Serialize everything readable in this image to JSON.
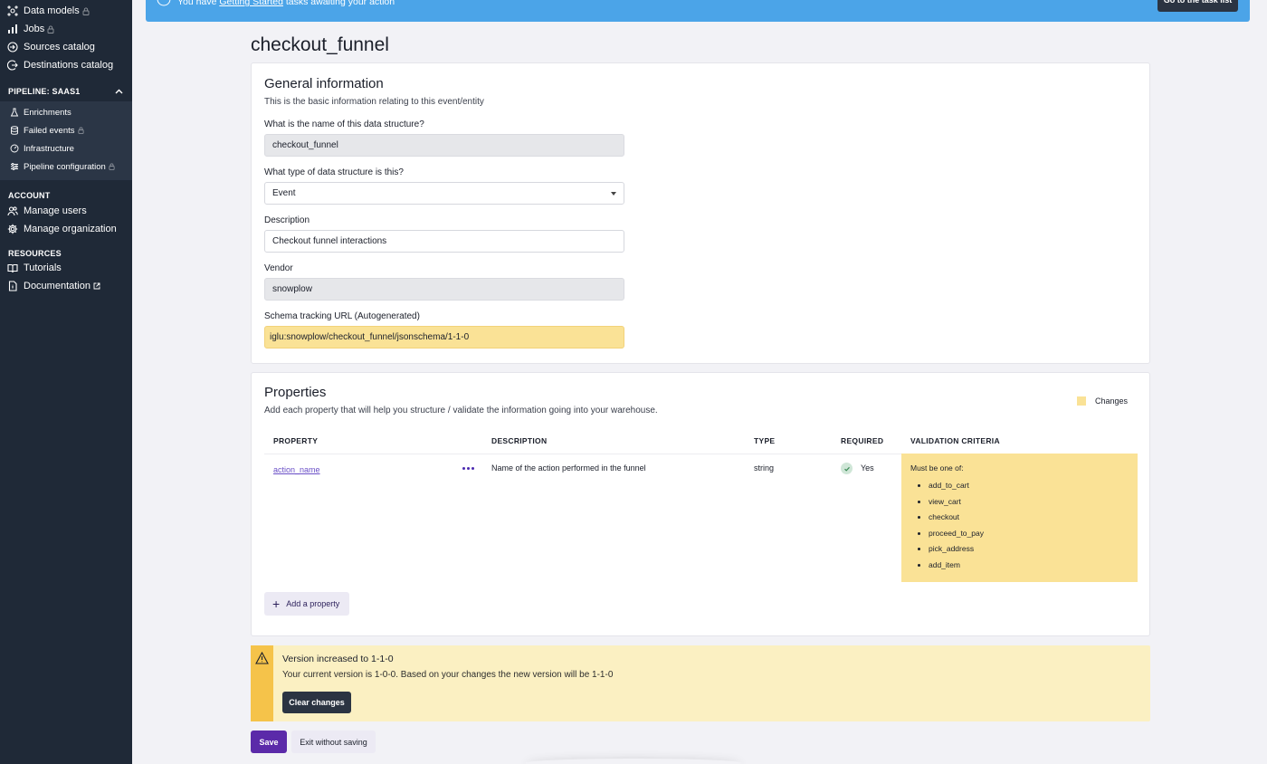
{
  "sidebar": {
    "top_items": [
      {
        "label": "Data models",
        "icon": "data-models-icon",
        "locked": true
      },
      {
        "label": "Jobs",
        "icon": "bar-chart-icon",
        "locked": true
      },
      {
        "label": "Sources catalog",
        "icon": "sources-icon",
        "locked": false
      },
      {
        "label": "Destinations catalog",
        "icon": "destinations-icon",
        "locked": false
      }
    ],
    "pipeline": {
      "header": "PIPELINE: SAAS1",
      "items": [
        {
          "label": "Enrichments",
          "icon": "flask-icon",
          "locked": false
        },
        {
          "label": "Failed events",
          "icon": "database-icon",
          "locked": true
        },
        {
          "label": "Infrastructure",
          "icon": "gauge-icon",
          "locked": false
        },
        {
          "label": "Pipeline configuration",
          "icon": "sliders-icon",
          "locked": true
        }
      ]
    },
    "account": {
      "label": "ACCOUNT",
      "items": [
        {
          "label": "Manage users",
          "icon": "users-icon"
        },
        {
          "label": "Manage organization",
          "icon": "gear-icon"
        }
      ]
    },
    "resources": {
      "label": "RESOURCES",
      "items": [
        {
          "label": "Tutorials",
          "icon": "book-icon"
        },
        {
          "label": "Documentation",
          "icon": "document-icon"
        }
      ]
    }
  },
  "banner": {
    "text_before": "You have ",
    "link": "Getting Started",
    "text_after": " tasks awaiting your action",
    "button": "Go to the task list"
  },
  "page_title": "checkout_funnel",
  "general": {
    "title": "General information",
    "subtitle": "This is the basic information relating to this event/entity",
    "name_label": "What is the name of this data structure?",
    "name_value": "checkout_funnel",
    "type_label": "What type of data structure is this?",
    "type_value": "Event",
    "description_label": "Description",
    "description_value": "Checkout funnel interactions",
    "vendor_label": "Vendor",
    "vendor_value": "snowplow",
    "url_label": "Schema tracking URL (Autogenerated)",
    "url_value": "iglu:snowplow/checkout_funnel/jsonschema/1-1-0"
  },
  "properties": {
    "title": "Properties",
    "subtitle": "Add each property that will help you structure / validate the information going into your warehouse.",
    "legend": "Changes",
    "legend_color": "#fae296",
    "columns": {
      "property": "PROPERTY",
      "description": "DESCRIPTION",
      "type": "TYPE",
      "required": "REQUIRED",
      "validation": "VALIDATION CRITERIA"
    },
    "row": {
      "name": "action_name",
      "description": "Name of the action performed in the funnel",
      "type": "string",
      "required": "Yes",
      "validation_intro": "Must be one of:",
      "validation_values": [
        "add_to_cart",
        "view_cart",
        "checkout",
        "proceed_to_pay",
        "pick_address",
        "add_item"
      ]
    },
    "add_button": "Add a property"
  },
  "warning": {
    "title": "Version increased to 1-1-0",
    "text": "Your current version is 1-0-0. Based on your changes the new version will be 1-1-0",
    "button": "Clear changes"
  },
  "actions": {
    "save": "Save",
    "exit": "Exit without saving"
  },
  "colors": {
    "sidebar": "#1f2937",
    "banner": "#4ba4e8",
    "primary": "#5b2aa9",
    "changed": "#fae296",
    "warning_bar": "#f5c34a"
  }
}
